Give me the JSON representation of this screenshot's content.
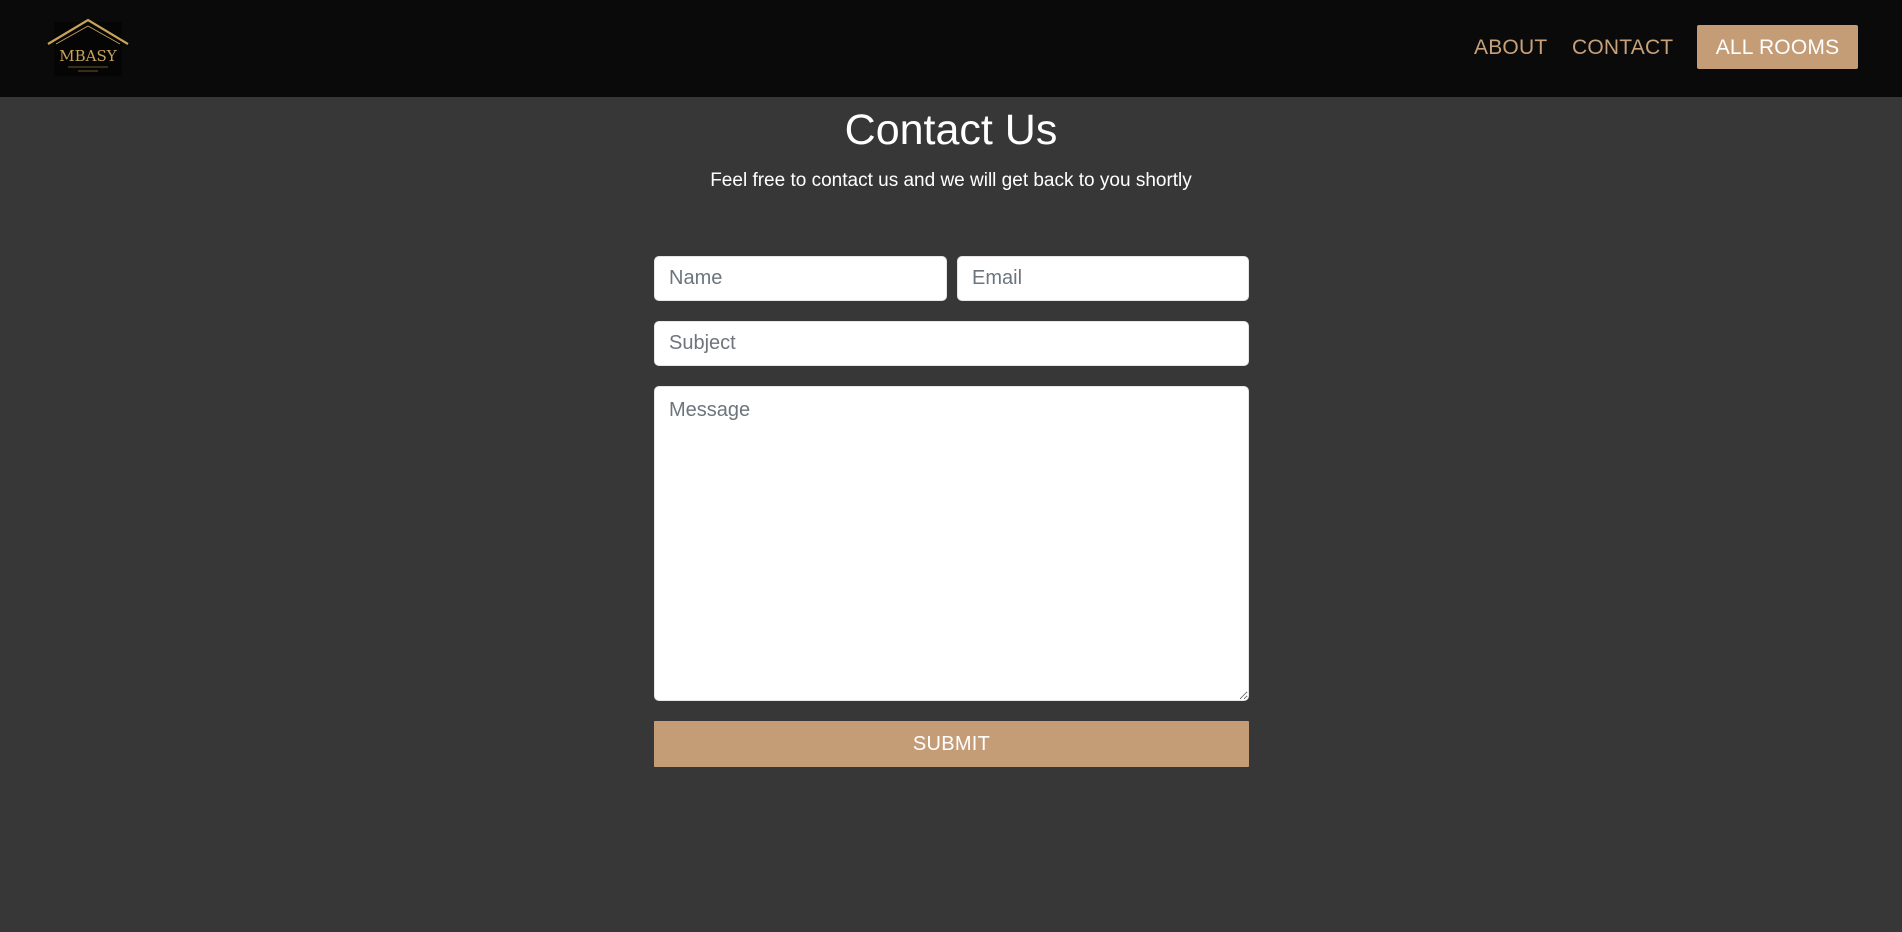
{
  "brand": {
    "logo_text": "MBASY",
    "accent_color": "#c49c76",
    "nav_link_color": "#c8a07a",
    "navbar_color": "#0a0a0a",
    "page_background": "#373737"
  },
  "nav": {
    "links": [
      {
        "label": "ABOUT"
      },
      {
        "label": "CONTACT"
      }
    ],
    "cta_label": "ALL ROOMS"
  },
  "contact": {
    "title": "Contact Us",
    "subtitle": "Feel free to contact us and we will get back to you shortly",
    "form": {
      "name": {
        "placeholder": "Name",
        "value": ""
      },
      "email": {
        "placeholder": "Email",
        "value": ""
      },
      "subject": {
        "placeholder": "Subject",
        "value": ""
      },
      "message": {
        "placeholder": "Message",
        "value": ""
      },
      "submit_label": "SUBMIT"
    }
  }
}
